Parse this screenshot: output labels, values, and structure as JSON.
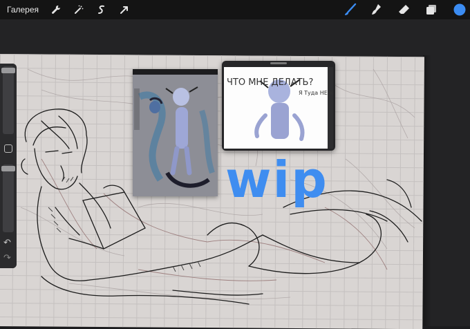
{
  "topbar": {
    "gallery_label": "Галерея",
    "tools_left": [
      {
        "name": "wrench-icon",
        "label": "Actions"
      },
      {
        "name": "magic-wand-icon",
        "label": "Adjustments"
      },
      {
        "name": "selection-icon",
        "label": "Selection"
      },
      {
        "name": "transform-arrow-icon",
        "label": "Transform"
      }
    ],
    "tools_right": [
      {
        "name": "brush-icon",
        "active": true
      },
      {
        "name": "smudge-icon",
        "active": false
      },
      {
        "name": "eraser-icon",
        "active": false
      },
      {
        "name": "layers-icon",
        "active": false
      },
      {
        "name": "color-swatch-icon",
        "color": "#3b8cf2"
      }
    ]
  },
  "sidebar": {
    "brush_size_level": 0.95,
    "opacity_level": 0.95
  },
  "canvas": {
    "wip_text": "wip",
    "reference_right_text_left": "ЧТО МНЕ ДЕЛАТЬ?",
    "reference_right_text_right": "Я Туда НЕ хочу"
  },
  "colors": {
    "accent": "#3b8cf2",
    "wip": "#3f8df0"
  }
}
